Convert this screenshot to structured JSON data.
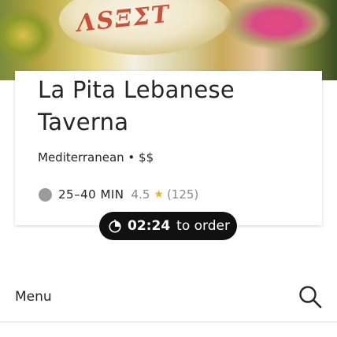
{
  "hero": {
    "image_alt": "Restaurant food photo",
    "sign_text": "~"
  },
  "restaurant": {
    "name": "La Pita Lebanese Taverna",
    "cuisine_line": "Mediterranean • $$",
    "eta": "25–40 MIN",
    "rating": "4.5",
    "review_count": "(125)"
  },
  "timer": {
    "time": "02:24",
    "suffix": "to order"
  },
  "menu": {
    "label": "Menu"
  },
  "icons": {
    "clock": "clock-icon",
    "star": "star-icon",
    "timer": "timer-icon",
    "search": "search-icon"
  },
  "colors": {
    "star": "#e3b726",
    "pill_bg": "#111111",
    "text": "#262626",
    "muted": "#8a8a8a"
  }
}
